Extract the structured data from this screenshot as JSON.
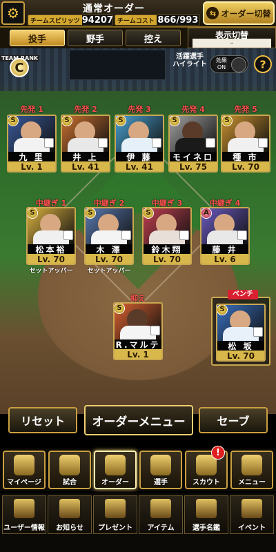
{
  "header": {
    "title": "通常オーダー",
    "team_spirit_label": "チームスピリッツ",
    "team_spirit_value": "94207",
    "team_cost_label": "チームコスト",
    "team_cost_value": "866/993",
    "order_switch_label": "オーダー切替",
    "order_switch_icon": "swap-icon"
  },
  "tabs": [
    {
      "label": "投手",
      "active": true
    },
    {
      "label": "野手",
      "active": false
    },
    {
      "label": "控え",
      "active": false
    }
  ],
  "display_toggle": {
    "label": "表示切替",
    "value": "–"
  },
  "team_rank": {
    "label": "TEAM RANK",
    "value": "C"
  },
  "highlight": {
    "label_line1": "活躍選手",
    "label_line2": "ハイライト",
    "effect_label": "効果",
    "state": "ON"
  },
  "help_label": "?",
  "starters": [
    {
      "slot": "先発 1",
      "name": "九 里",
      "level": "Lv. 1",
      "rank": "S",
      "colors": {
        "bg": "#3a5a9a",
        "uniform": "#f2f2f2",
        "skin": "#d8a882"
      }
    },
    {
      "slot": "先発 2",
      "name": "井 上",
      "level": "Lv. 41",
      "rank": "S",
      "colors": {
        "bg": "#c87030",
        "uniform": "#e8e8e8",
        "skin": "#d8a882"
      }
    },
    {
      "slot": "先発 3",
      "name": "伊 藤",
      "level": "Lv. 41",
      "rank": "S",
      "colors": {
        "bg": "#4aa0d0",
        "uniform": "#e6f0f8",
        "skin": "#d8a882"
      }
    },
    {
      "slot": "先発 4",
      "name": "モイネロ",
      "level": "Lv. 75",
      "rank": "S",
      "colors": {
        "bg": "#a0a0a0",
        "uniform": "#1a1a1a",
        "skin": "#5a3a28"
      }
    },
    {
      "slot": "先発 5",
      "name": "種 市",
      "level": "Lv. 70",
      "rank": "S",
      "colors": {
        "bg": "#c89030",
        "uniform": "#f0f0f0",
        "skin": "#d8a882"
      }
    }
  ],
  "relievers": [
    {
      "slot": "中継ぎ 1",
      "name": "松本裕",
      "level": "Lv. 70",
      "rank": "S",
      "note": "セットアッパー",
      "colors": {
        "bg": "#d8b040",
        "uniform": "#f0f0f0",
        "skin": "#d8a882"
      }
    },
    {
      "slot": "中継ぎ 2",
      "name": "木 澤",
      "level": "Lv. 70",
      "rank": "S",
      "note": "セットアッパー",
      "colors": {
        "bg": "#5a7ab0",
        "uniform": "#f4f4f4",
        "skin": "#d8a882"
      }
    },
    {
      "slot": "中継ぎ 3",
      "name": "鈴木翔",
      "level": "Lv. 70",
      "rank": "S",
      "note": "",
      "colors": {
        "bg": "#c04050",
        "uniform": "#e8e0d8",
        "skin": "#d8a882"
      }
    },
    {
      "slot": "中継ぎ 4",
      "name": "藤 井",
      "level": "Lv. 6",
      "rank": "A",
      "note": "",
      "colors": {
        "bg": "#6a5ac0",
        "uniform": "#e8e8e8",
        "skin": "#d8a882"
      }
    }
  ],
  "closer": {
    "slot": "抑え",
    "name": "R.マルティネス",
    "level": "Lv. 1",
    "rank": "S",
    "colors": {
      "bg": "#d86030",
      "uniform": "#f4f4f4",
      "skin": "#5a3a28"
    }
  },
  "bench": {
    "slot": "ベンチ",
    "name": "松 坂",
    "level": "Lv. 70",
    "rank": "S",
    "colors": {
      "bg": "#3a70c0",
      "uniform": "#e8f0fa",
      "skin": "#d8a882"
    }
  },
  "actions": {
    "reset": "リセット",
    "order_menu": "オーダーメニュー",
    "save": "セーブ"
  },
  "nav_main": [
    {
      "label": "マイページ",
      "icon": "my-page-icon"
    },
    {
      "label": "試合",
      "icon": "stadium-icon"
    },
    {
      "label": "オーダー",
      "icon": "order-icon",
      "active": true
    },
    {
      "label": "選手",
      "icon": "player-icon"
    },
    {
      "label": "スカウト",
      "icon": "scout-icon",
      "alert": "!"
    },
    {
      "label": "メニュー",
      "icon": "menu-icon"
    }
  ],
  "nav_sub": [
    {
      "label": "ユーザー情報",
      "icon": "user-info-icon"
    },
    {
      "label": "お知らせ",
      "icon": "news-icon"
    },
    {
      "label": "プレゼント",
      "icon": "present-icon"
    },
    {
      "label": "アイテム",
      "icon": "item-icon"
    },
    {
      "label": "選手名鑑",
      "icon": "directory-icon"
    },
    {
      "label": "イベント",
      "icon": "event-icon"
    }
  ]
}
